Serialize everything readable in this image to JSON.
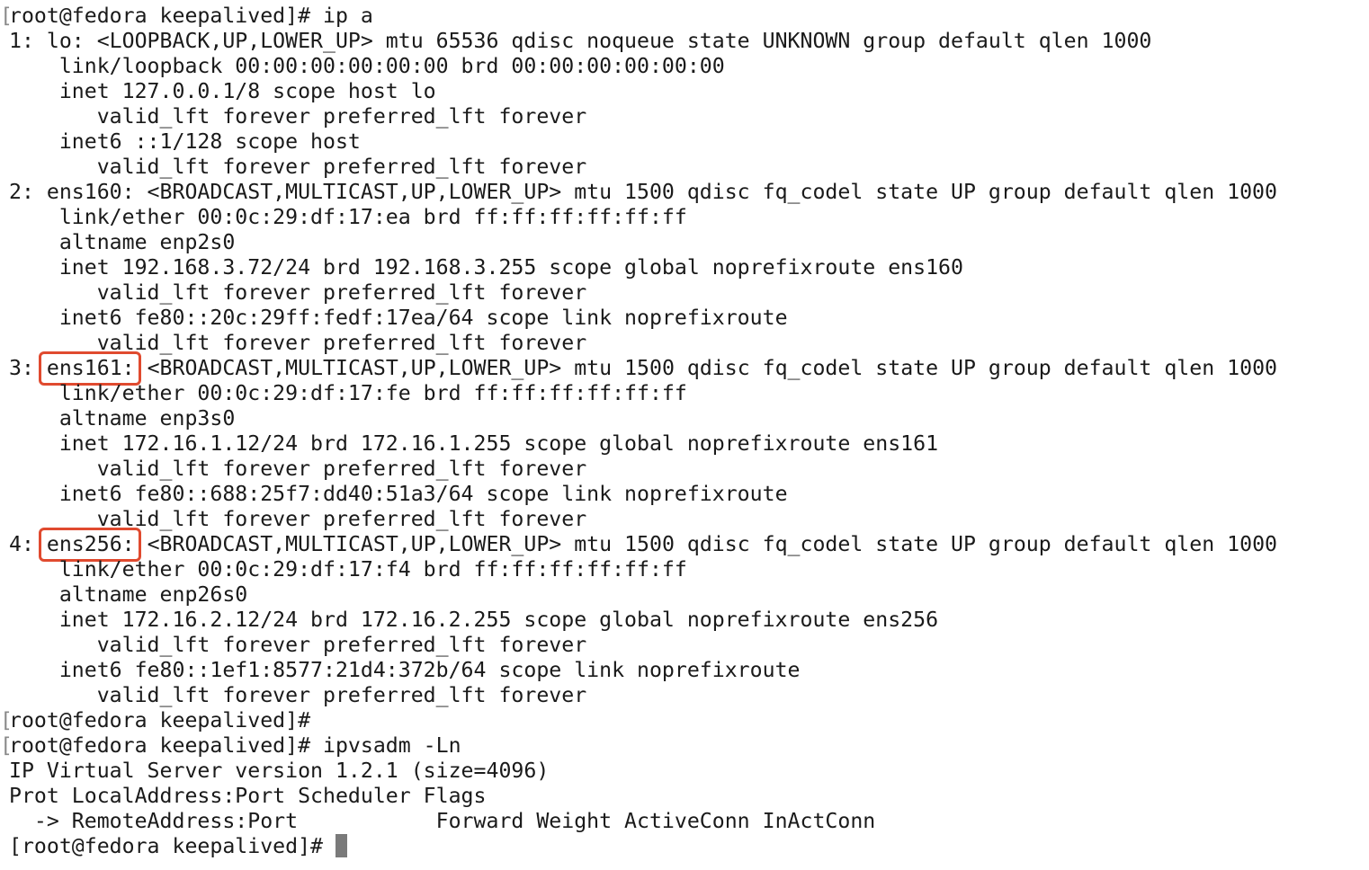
{
  "terminal": {
    "lines": [
      {
        "gutter": "[",
        "text": "[root@fedora keepalived]# ip a"
      },
      {
        "gutter": "",
        "text": "1: lo: <LOOPBACK,UP,LOWER_UP> mtu 65536 qdisc noqueue state UNKNOWN group default qlen 1000"
      },
      {
        "gutter": "",
        "text": "    link/loopback 00:00:00:00:00:00 brd 00:00:00:00:00:00"
      },
      {
        "gutter": "",
        "text": "    inet 127.0.0.1/8 scope host lo"
      },
      {
        "gutter": "",
        "text": "       valid_lft forever preferred_lft forever"
      },
      {
        "gutter": "",
        "text": "    inet6 ::1/128 scope host"
      },
      {
        "gutter": "",
        "text": "       valid_lft forever preferred_lft forever"
      },
      {
        "gutter": "",
        "text": "2: ens160: <BROADCAST,MULTICAST,UP,LOWER_UP> mtu 1500 qdisc fq_codel state UP group default qlen 1000"
      },
      {
        "gutter": "",
        "text": "    link/ether 00:0c:29:df:17:ea brd ff:ff:ff:ff:ff:ff"
      },
      {
        "gutter": "",
        "text": "    altname enp2s0"
      },
      {
        "gutter": "",
        "text": "    inet 192.168.3.72/24 brd 192.168.3.255 scope global noprefixroute ens160"
      },
      {
        "gutter": "",
        "text": "       valid_lft forever preferred_lft forever"
      },
      {
        "gutter": "",
        "text": "    inet6 fe80::20c:29ff:fedf:17ea/64 scope link noprefixroute"
      },
      {
        "gutter": "",
        "text": "       valid_lft forever preferred_lft forever"
      },
      {
        "gutter": "",
        "prefix": "3: ",
        "highlight": "ens161:",
        "text": " <BROADCAST,MULTICAST,UP,LOWER_UP> mtu 1500 qdisc fq_codel state UP group default qlen 1000"
      },
      {
        "gutter": "",
        "text": "    link/ether 00:0c:29:df:17:fe brd ff:ff:ff:ff:ff:ff"
      },
      {
        "gutter": "",
        "text": "    altname enp3s0"
      },
      {
        "gutter": "",
        "text": "    inet 172.16.1.12/24 brd 172.16.1.255 scope global noprefixroute ens161"
      },
      {
        "gutter": "",
        "text": "       valid_lft forever preferred_lft forever"
      },
      {
        "gutter": "",
        "text": "    inet6 fe80::688:25f7:dd40:51a3/64 scope link noprefixroute"
      },
      {
        "gutter": "",
        "text": "       valid_lft forever preferred_lft forever"
      },
      {
        "gutter": "",
        "prefix": "4: ",
        "highlight": "ens256:",
        "text": " <BROADCAST,MULTICAST,UP,LOWER_UP> mtu 1500 qdisc fq_codel state UP group default qlen 1000"
      },
      {
        "gutter": "",
        "text": "    link/ether 00:0c:29:df:17:f4 brd ff:ff:ff:ff:ff:ff"
      },
      {
        "gutter": "",
        "text": "    altname enp26s0"
      },
      {
        "gutter": "",
        "text": "    inet 172.16.2.12/24 brd 172.16.2.255 scope global noprefixroute ens256"
      },
      {
        "gutter": "",
        "text": "       valid_lft forever preferred_lft forever"
      },
      {
        "gutter": "",
        "text": "    inet6 fe80::1ef1:8577:21d4:372b/64 scope link noprefixroute"
      },
      {
        "gutter": "",
        "text": "       valid_lft forever preferred_lft forever"
      },
      {
        "gutter": "[",
        "text": "[root@fedora keepalived]#"
      },
      {
        "gutter": "[",
        "text": "[root@fedora keepalived]# ipvsadm -Ln"
      },
      {
        "gutter": "",
        "text": "IP Virtual Server version 1.2.1 (size=4096)"
      },
      {
        "gutter": "",
        "text": "Prot LocalAddress:Port Scheduler Flags"
      },
      {
        "gutter": "",
        "text": "  -> RemoteAddress:Port           Forward Weight ActiveConn InActConn"
      },
      {
        "gutter": "",
        "text": "[root@fedora keepalived]# ",
        "cursor": true
      }
    ]
  },
  "colors": {
    "background": "#ffffff",
    "text": "#1a1a1a",
    "highlight_border": "#e04a2f",
    "cursor": "#7a7a7a"
  }
}
